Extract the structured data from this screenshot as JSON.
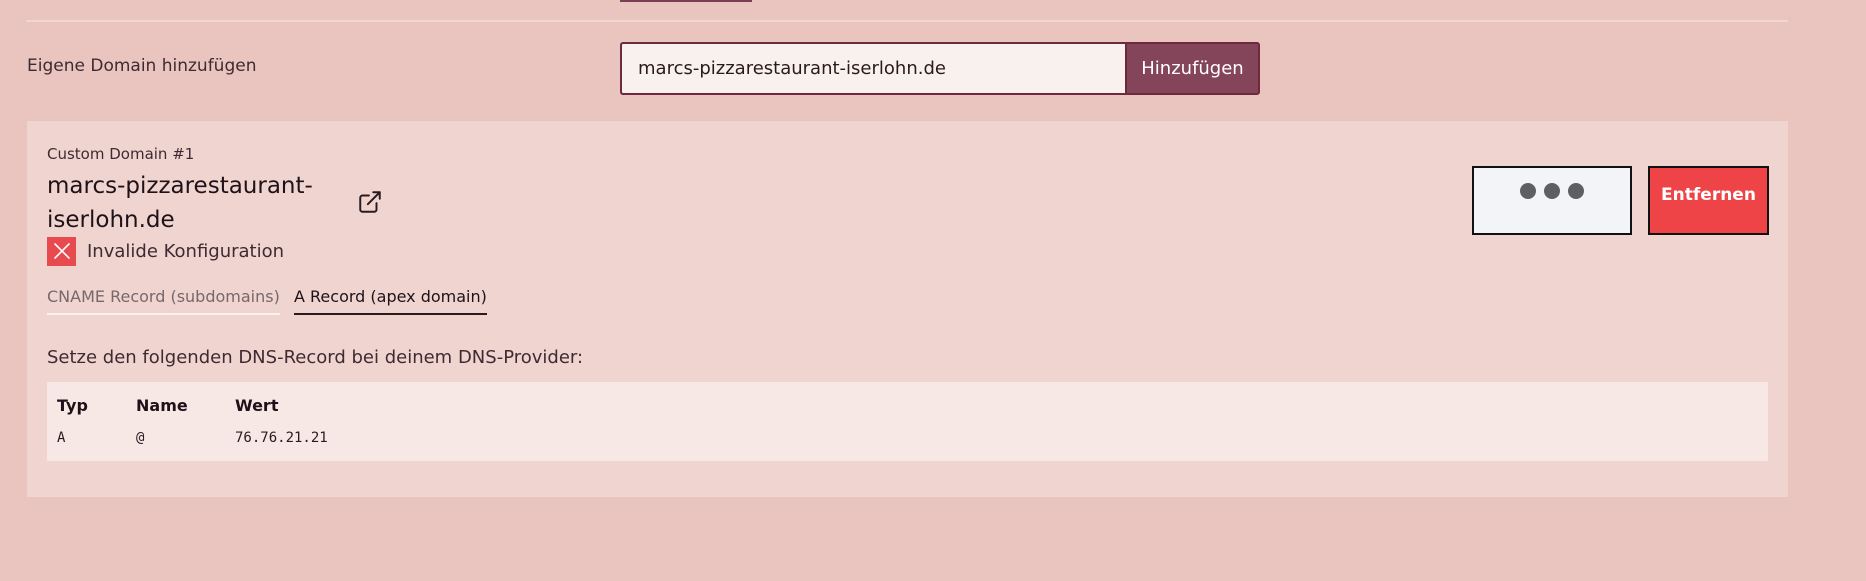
{
  "add_domain": {
    "label": "Eigene Domain hinzufügen",
    "input_value": "marcs-pizzarestaurant-iserlohn.de",
    "button_label": "Hinzufügen"
  },
  "domain_card": {
    "subtitle": "Custom Domain #1",
    "title": "marcs-pizzarestaurant-iserlohn.de",
    "status_text": "Invalide Konfiguration",
    "status_color": "#e74a4f",
    "external_link_icon": "external-link-icon",
    "more_icon": "ellipsis-icon",
    "remove_label": "Entfernen",
    "remove_color": "#ee4347",
    "tabs": [
      {
        "label": "CNAME Record (subdomains)",
        "active": false
      },
      {
        "label": "A Record (apex domain)",
        "active": true
      }
    ],
    "instruction": "Setze den folgenden DNS-Record bei deinem DNS-Provider:",
    "dns_table": {
      "headers": [
        "Typ",
        "Name",
        "Wert"
      ],
      "rows": [
        [
          "A",
          "@",
          "76.76.21.21"
        ]
      ]
    }
  },
  "colors": {
    "page_background": "#eac4be",
    "card_background": "#f0d4d0",
    "accent": "#84445a"
  }
}
